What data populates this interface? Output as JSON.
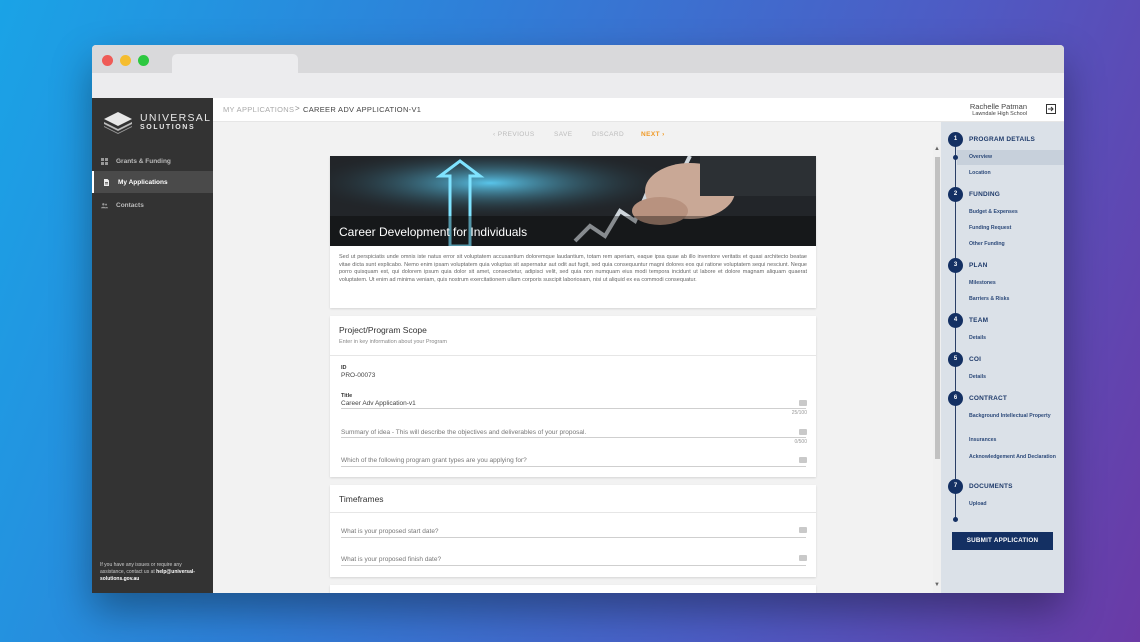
{
  "brand": {
    "line1": "UNIVERSAL",
    "line2": "SOLUTIONS"
  },
  "sidebar": {
    "items": [
      {
        "label": "Grants & Funding",
        "icon": "grid-icon"
      },
      {
        "label": "My Applications",
        "icon": "document-icon"
      },
      {
        "label": "Contacts",
        "icon": "people-icon"
      }
    ],
    "help_text": "If you have any issues or require any assistance, contact us at ",
    "help_email": "help@universal-solutions.gov.au"
  },
  "header": {
    "breadcrumb_root": "MY APPLICATIONS",
    "breadcrumb_sep": ">",
    "breadcrumb_current": "CAREER ADV APPLICATION-V1",
    "user_name": "Rachelle Patman",
    "user_school": "Lawndale High School"
  },
  "actions": {
    "previous": "PREVIOUS",
    "save": "SAVE",
    "discard": "DISCARD",
    "next": "NEXT"
  },
  "hero": {
    "title": "Career Development for Individuals",
    "intro": "Sed ut perspiciatis unde omnis iste natus error sit voluptatem accusantium doloremque laudantium, totam rem aperiam, eaque ipsa quae ab illo inventore veritatis et quasi architecto beatae vitae dicta sunt explicabo. Nemo enim ipsam voluptatem quia voluptas sit aspernatur aut odit aut fugit, sed quia consequuntur magni dolores eos qui ratione voluptatem sequi nesciunt. Neque porro quisquam est, qui dolorem ipsum quia dolor sit amet, consectetur, adipisci velit, sed quia non numquam eius modi tempora incidunt ut labore et dolore magnam aliquam quaerat voluptatem. Ut enim ad minima veniam, quis nostrum exercitationem ullam corporis suscipit laboriosam, nisi ut aliquid ex ea commodi consequatur."
  },
  "scope": {
    "title": "Project/Program Scope",
    "subtitle": "Enter in key information about your Program",
    "id_label": "ID",
    "id_value": "PRO-00073",
    "title_label": "Title",
    "title_value": "Career Adv Application-v1",
    "title_count": "25/100",
    "summary_placeholder": "Summary of idea - This will describe the objectives and deliverables of your proposal.",
    "summary_count": "0/500",
    "grant_type_placeholder": "Which of the following program grant types are you applying for?"
  },
  "timeframes": {
    "title": "Timeframes",
    "start_placeholder": "What is your proposed start date?",
    "finish_placeholder": "What is your proposed finish date?"
  },
  "steps": [
    {
      "num": "1",
      "title": "PROGRAM DETAILS",
      "subs": [
        "Overview",
        "Location"
      ]
    },
    {
      "num": "2",
      "title": "FUNDING",
      "subs": [
        "Budget & Expenses",
        "Funding Request",
        "Other Funding"
      ]
    },
    {
      "num": "3",
      "title": "PLAN",
      "subs": [
        "Milestones",
        "Barriers & Risks"
      ]
    },
    {
      "num": "4",
      "title": "TEAM",
      "subs": [
        "Details"
      ]
    },
    {
      "num": "5",
      "title": "COI",
      "subs": [
        "Details"
      ]
    },
    {
      "num": "6",
      "title": "CONTRACT",
      "subs": [
        "Background Intellectual Property",
        "Insurances",
        "Acknowledgement And Declaration"
      ]
    },
    {
      "num": "7",
      "title": "DOCUMENTS",
      "subs": [
        "Upload"
      ]
    }
  ],
  "submit_label": "SUBMIT APPLICATION",
  "colors": {
    "accent": "#f09a26",
    "navy": "#143063",
    "sidebar": "#333333",
    "panel": "#dbe1e8"
  }
}
